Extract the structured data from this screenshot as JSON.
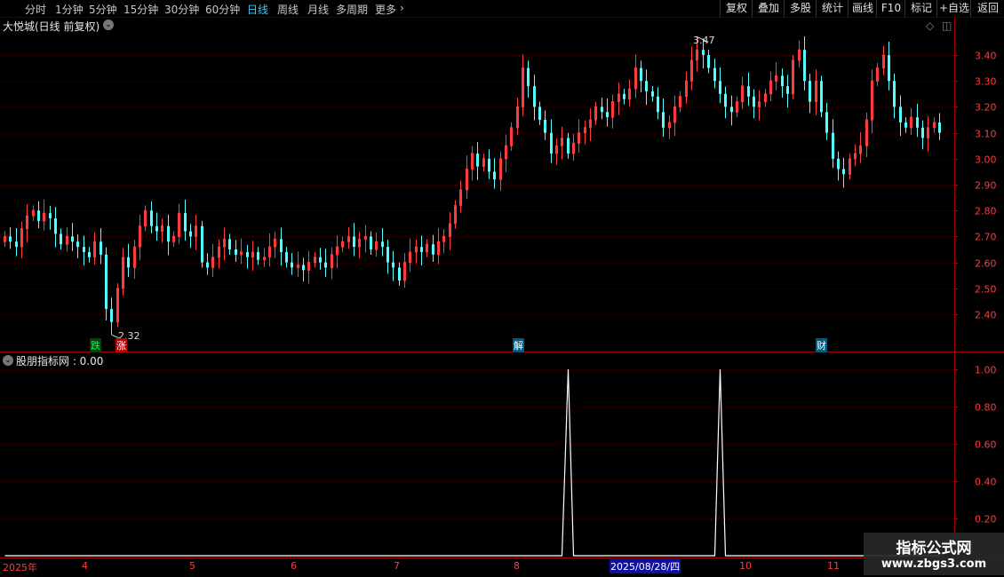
{
  "toolbar": {
    "periods": [
      "分时",
      "1分钟",
      "5分钟",
      "15分钟",
      "30分钟",
      "60分钟",
      "日线",
      "周线",
      "月线",
      "多周期",
      "更多"
    ],
    "active_period": "日线",
    "buttons": [
      "复权",
      "叠加",
      "多股",
      "统计",
      "画线",
      "F10",
      "标记",
      "+自选",
      "返回"
    ]
  },
  "main": {
    "title": "大悦城(日线 前复权)",
    "high_label": "3.47",
    "low_label": "2.32"
  },
  "signals": {
    "die": "跌",
    "zhang": "涨",
    "jie": "解",
    "cai": "财"
  },
  "indicator": {
    "title": "股朋指标网 : 0.00"
  },
  "xaxis": {
    "year": "2025年",
    "months": [
      "4",
      "5",
      "6",
      "7",
      "8",
      "10",
      "11"
    ],
    "cursor_date": "2025/08/28/四"
  },
  "watermark": {
    "line1": "指标公式网",
    "line2": "www.zbgs3.com"
  },
  "colors": {
    "up": "#ff3c3c",
    "down": "#54ffff",
    "grid": "#5a0000",
    "axis": "#a00000",
    "indicator_line": "#ffffff",
    "active": "#33ccff"
  },
  "chart_data": [
    {
      "type": "candlestick",
      "title": "大悦城(日线 前复权)",
      "ylim": [
        2.3,
        3.48
      ],
      "yticks": [
        2.4,
        2.5,
        2.6,
        2.7,
        2.8,
        2.9,
        3.0,
        3.1,
        3.2,
        3.3,
        3.4
      ],
      "grid": true,
      "max": {
        "value": 3.47,
        "label": "3.47"
      },
      "min": {
        "value": 2.32,
        "label": "2.32"
      },
      "closes": [
        2.7,
        2.68,
        2.66,
        2.73,
        2.78,
        2.8,
        2.76,
        2.79,
        2.77,
        2.71,
        2.67,
        2.7,
        2.68,
        2.66,
        2.64,
        2.62,
        2.68,
        2.63,
        2.42,
        2.37,
        2.5,
        2.62,
        2.58,
        2.66,
        2.74,
        2.8,
        2.74,
        2.72,
        2.74,
        2.68,
        2.7,
        2.79,
        2.72,
        2.7,
        2.74,
        2.6,
        2.58,
        2.62,
        2.66,
        2.69,
        2.65,
        2.63,
        2.64,
        2.62,
        2.64,
        2.61,
        2.62,
        2.66,
        2.69,
        2.64,
        2.6,
        2.58,
        2.59,
        2.57,
        2.6,
        2.62,
        2.6,
        2.58,
        2.63,
        2.66,
        2.68,
        2.7,
        2.66,
        2.69,
        2.7,
        2.65,
        2.68,
        2.66,
        2.6,
        2.58,
        2.53,
        2.6,
        2.64,
        2.66,
        2.64,
        2.67,
        2.63,
        2.68,
        2.7,
        2.75,
        2.82,
        2.88,
        2.96,
        3.02,
        2.97,
        3.0,
        2.95,
        2.92,
        3.0,
        3.05,
        3.12,
        3.2,
        3.35,
        3.28,
        3.2,
        3.15,
        3.1,
        3.02,
        3.05,
        3.08,
        3.02,
        3.06,
        3.1,
        3.12,
        3.15,
        3.2,
        3.18,
        3.16,
        3.22,
        3.25,
        3.23,
        3.27,
        3.35,
        3.3,
        3.26,
        3.24,
        3.18,
        3.12,
        3.14,
        3.2,
        3.24,
        3.3,
        3.38,
        3.42,
        3.4,
        3.35,
        3.3,
        3.25,
        3.2,
        3.18,
        3.22,
        3.28,
        3.24,
        3.2,
        3.22,
        3.25,
        3.3,
        3.32,
        3.28,
        3.25,
        3.38,
        3.42,
        3.3,
        3.22,
        3.3,
        3.18,
        3.1,
        3.0,
        2.96,
        2.94,
        3.0,
        3.02,
        3.05,
        3.15,
        3.3,
        3.35,
        3.4,
        3.3,
        3.2,
        3.14,
        3.12,
        3.16,
        3.12,
        3.08,
        3.12,
        3.14,
        3.1
      ],
      "opens": [
        2.68,
        2.7,
        2.68,
        2.66,
        2.73,
        2.78,
        2.8,
        2.76,
        2.79,
        2.77,
        2.71,
        2.67,
        2.7,
        2.68,
        2.66,
        2.64,
        2.62,
        2.68,
        2.63,
        2.42,
        2.37,
        2.5,
        2.62,
        2.58,
        2.66,
        2.74,
        2.8,
        2.74,
        2.72,
        2.74,
        2.68,
        2.7,
        2.79,
        2.72,
        2.7,
        2.74,
        2.6,
        2.58,
        2.62,
        2.66,
        2.69,
        2.65,
        2.63,
        2.64,
        2.62,
        2.64,
        2.61,
        2.62,
        2.66,
        2.69,
        2.64,
        2.6,
        2.58,
        2.59,
        2.57,
        2.6,
        2.62,
        2.6,
        2.58,
        2.63,
        2.66,
        2.68,
        2.7,
        2.66,
        2.69,
        2.7,
        2.65,
        2.68,
        2.66,
        2.6,
        2.58,
        2.53,
        2.6,
        2.64,
        2.66,
        2.64,
        2.67,
        2.63,
        2.68,
        2.7,
        2.75,
        2.82,
        2.88,
        2.96,
        3.02,
        2.97,
        3.0,
        2.95,
        2.92,
        3.0,
        3.05,
        3.12,
        3.2,
        3.35,
        3.28,
        3.2,
        3.15,
        3.1,
        3.02,
        3.05,
        3.08,
        3.02,
        3.06,
        3.1,
        3.12,
        3.15,
        3.2,
        3.18,
        3.16,
        3.22,
        3.25,
        3.23,
        3.27,
        3.35,
        3.3,
        3.26,
        3.24,
        3.18,
        3.12,
        3.14,
        3.2,
        3.24,
        3.3,
        3.38,
        3.42,
        3.4,
        3.35,
        3.3,
        3.25,
        3.2,
        3.18,
        3.22,
        3.28,
        3.24,
        3.2,
        3.22,
        3.25,
        3.3,
        3.32,
        3.28,
        3.25,
        3.38,
        3.42,
        3.3,
        3.22,
        3.3,
        3.18,
        3.1,
        3.0,
        2.96,
        2.94,
        3.0,
        3.02,
        3.05,
        3.15,
        3.3,
        3.35,
        3.4,
        3.3,
        3.2,
        3.14,
        3.12,
        3.16,
        3.12,
        3.08,
        3.12,
        3.14
      ]
    },
    {
      "type": "line",
      "title": "股朋指标网",
      "ylim": [
        0.1,
        1.05
      ],
      "yticks": [
        0.2,
        0.4,
        0.6,
        0.8,
        1.0
      ],
      "grid": true,
      "series": [
        {
          "values_spikes_at_index": [
            100,
            127
          ],
          "spike_value": 1.0,
          "base_value": 0.0
        }
      ]
    }
  ]
}
